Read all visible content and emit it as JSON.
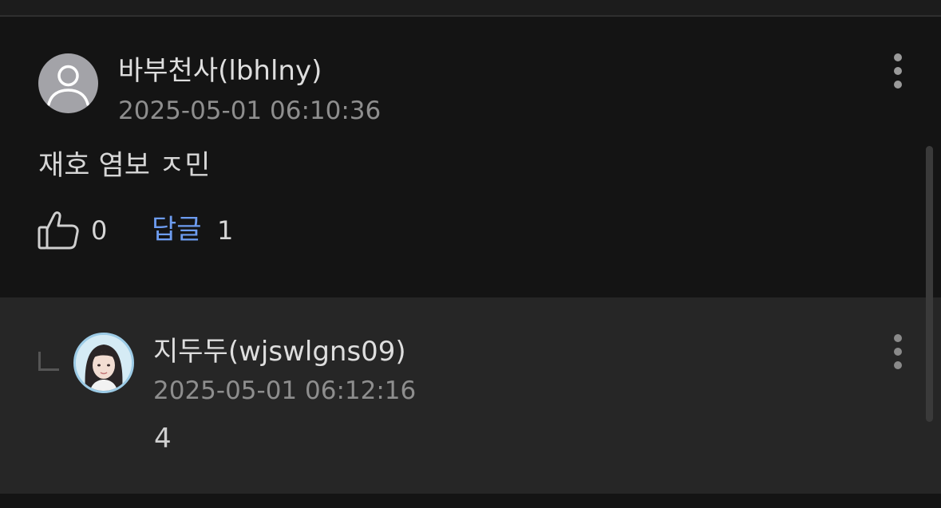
{
  "comment": {
    "author": "바부천사(lbhlny)",
    "timestamp": "2025-05-01 06:10:36",
    "body": "재호 염보 ㅈ민",
    "like_icon": "thumbs-up-icon",
    "like_count": "0",
    "reply_label": "답글",
    "reply_count": "1",
    "avatar_icon": "default-user-icon",
    "menu_icon": "more-vertical-icon"
  },
  "reply": {
    "author": "지두두(wjswlgns09)",
    "timestamp": "2025-05-01 06:12:16",
    "body": "4",
    "indent_icon": "reply-corner-icon",
    "avatar_icon": "profile-photo",
    "menu_icon": "more-vertical-icon"
  },
  "colors": {
    "background": "#141414",
    "reply_background": "#262626",
    "accent": "#6d9cf0",
    "text": "#dedede",
    "muted": "#8e8e8e"
  }
}
